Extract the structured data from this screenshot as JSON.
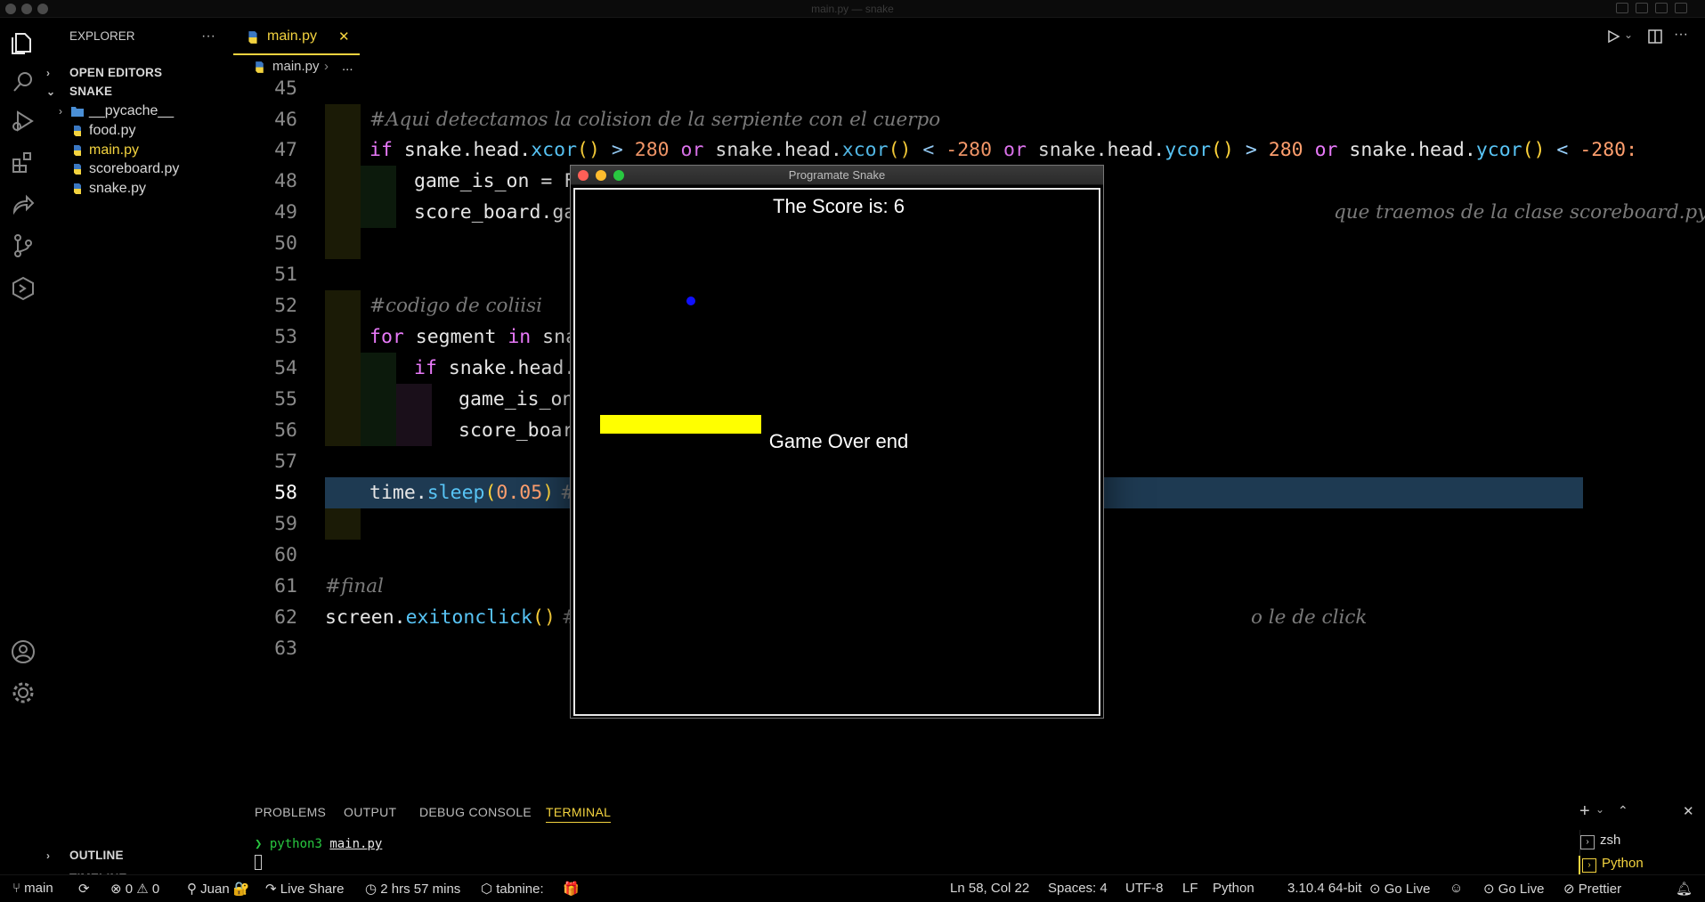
{
  "window": {
    "title": "main.py — snake"
  },
  "explorer": {
    "title": "EXPLORER",
    "more": "···",
    "open_editors": "OPEN EDITORS",
    "folder": "SNAKE",
    "items": [
      {
        "label": "__pycache__",
        "type": "folder"
      },
      {
        "label": "food.py",
        "type": "py"
      },
      {
        "label": "main.py",
        "type": "py",
        "active": true
      },
      {
        "label": "scoreboard.py",
        "type": "py"
      },
      {
        "label": "snake.py",
        "type": "py"
      }
    ],
    "outline": "OUTLINE",
    "timeline": "TIMELINE"
  },
  "tab": {
    "label": "main.py",
    "close": "✕"
  },
  "breadcrumb": {
    "file": "main.py",
    "rest": "..."
  },
  "code_lines": {
    "l45": "45",
    "l46": "46",
    "l47": "47",
    "l48": "48",
    "l49": "49",
    "l50": "50",
    "l51": "51",
    "l52": "52",
    "l53": "53",
    "l54": "54",
    "l55": "55",
    "l56": "56",
    "l57": "57",
    "l58": "58",
    "l59": "59",
    "l60": "60",
    "l61": "61",
    "l62": "62",
    "l63": "63"
  },
  "code": {
    "c46": "#Aqui detectamos la colision de la serpiente con el cuerpo",
    "c47_a": "if",
    "c47_b": " snake.head.",
    "c47_c": "xcor",
    "c47_d": "()",
    "c47_e": " > ",
    "c47_f": "280",
    "c47_g": " or",
    "c47_h": " snake.head.",
    "c47_i": "xcor",
    "c47_j": "()",
    "c47_k": " < ",
    "c47_l": "-280",
    "c47_m": " or",
    "c47_n": " snake.head.",
    "c47_o": "ycor",
    "c47_p": "()",
    "c47_q": " > ",
    "c47_r": "280",
    "c47_s": " or",
    "c47_t": " snake.head.",
    "c47_u": "ycor",
    "c47_v": "()",
    "c47_w": " < ",
    "c47_x": "-280:",
    "c48": "game_is_on = F",
    "c49_a": "score_board.ga",
    "c49_b": "que traemos de la clase scoreboard.py",
    "c52": "#codigo de coliisi",
    "c53_a": "for",
    "c53_b": " segment ",
    "c53_c": "in",
    "c53_d": " sna",
    "c54_a": "if",
    "c54_b": " snake.head.",
    "c55": "game_is_on",
    "c56": "score_boar",
    "c58_a": "time.",
    "c58_b": "sleep",
    "c58_c": "(",
    "c58_d": "0.05",
    "c58_e": ")",
    "c58_f": " #",
    "c61": "#final",
    "c62_a": "screen.",
    "c62_b": "exitonclick",
    "c62_c": "()",
    "c62_d": " #",
    "c62_e": "o le de click"
  },
  "turtle": {
    "title": "Programate Snake",
    "score": "The Score is: 6",
    "game_over": "Game Over end"
  },
  "panel": {
    "tabs": [
      "PROBLEMS",
      "OUTPUT",
      "DEBUG CONSOLE",
      "TERMINAL"
    ],
    "active_tab": "TERMINAL",
    "prompt_symbol": "❯",
    "command": "python3",
    "arg": "main.py",
    "terminals": [
      "zsh",
      "Python"
    ]
  },
  "status": {
    "branch": "main",
    "errors": "0",
    "warnings": "0",
    "user": "Juan",
    "live_share": "Live Share",
    "time": "2 hrs 57 mins",
    "tabnine": "tabnine:",
    "position": "Ln 58, Col 22",
    "spaces": "Spaces: 4",
    "encoding": "UTF-8",
    "eol": "LF",
    "language": "Python",
    "interpreter": "3.10.4 64-bit",
    "go_live_1": "Go Live",
    "go_live_2": "Go Live",
    "prettier": "Prettier"
  }
}
